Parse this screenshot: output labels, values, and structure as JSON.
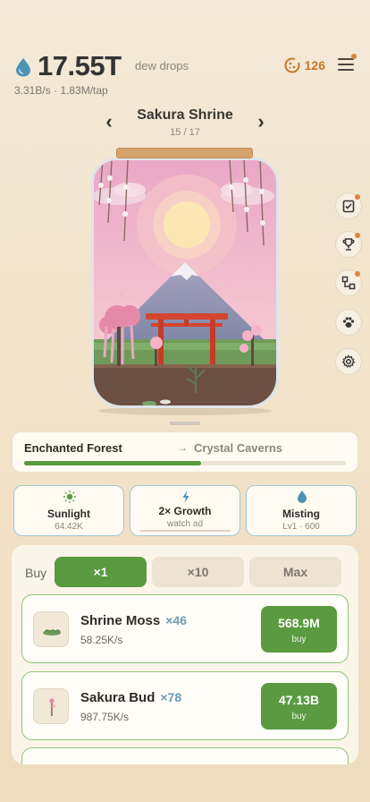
{
  "header": {
    "dew_amount": "17.55T",
    "dew_unit": "dew drops",
    "rates": "3.31B/s  ·  1.83M/tap",
    "coins": "126"
  },
  "habitat": {
    "name": "Sakura Shrine",
    "index": "15 / 17"
  },
  "progress": {
    "from": "Enchanted Forest",
    "arrow": "→",
    "to": "Crystal Caverns",
    "fraction": 0.55
  },
  "boosts": [
    {
      "icon": "sun-icon",
      "title": "Sunlight",
      "sub": "64.42K"
    },
    {
      "icon": "lightning-icon",
      "title": "2× Growth",
      "sub": "watch ad"
    },
    {
      "icon": "droplet-icon",
      "title": "Misting",
      "sub": "Lv1 · 600"
    }
  ],
  "shop": {
    "buy_label": "Buy",
    "multipliers": [
      "×1",
      "×10",
      "Max"
    ],
    "active_multiplier": "×1",
    "items": [
      {
        "name": "Shrine Moss",
        "count": "×46",
        "rate": "58.25K/s",
        "price": "568.9M",
        "buy_label": "buy"
      },
      {
        "name": "Sakura Bud",
        "count": "×78",
        "rate": "987.75K/s",
        "price": "47.13B",
        "buy_label": "buy"
      }
    ]
  },
  "side_buttons": [
    "clipboard-check-icon",
    "trophy-icon",
    "hierarchy-icon",
    "paw-icon",
    "gear-icon"
  ],
  "colors": {
    "accent_green": "#5a9a40",
    "coin_orange": "#c47a2c",
    "boost_border": "#9fc8d4",
    "background": "#f5e8d3"
  }
}
